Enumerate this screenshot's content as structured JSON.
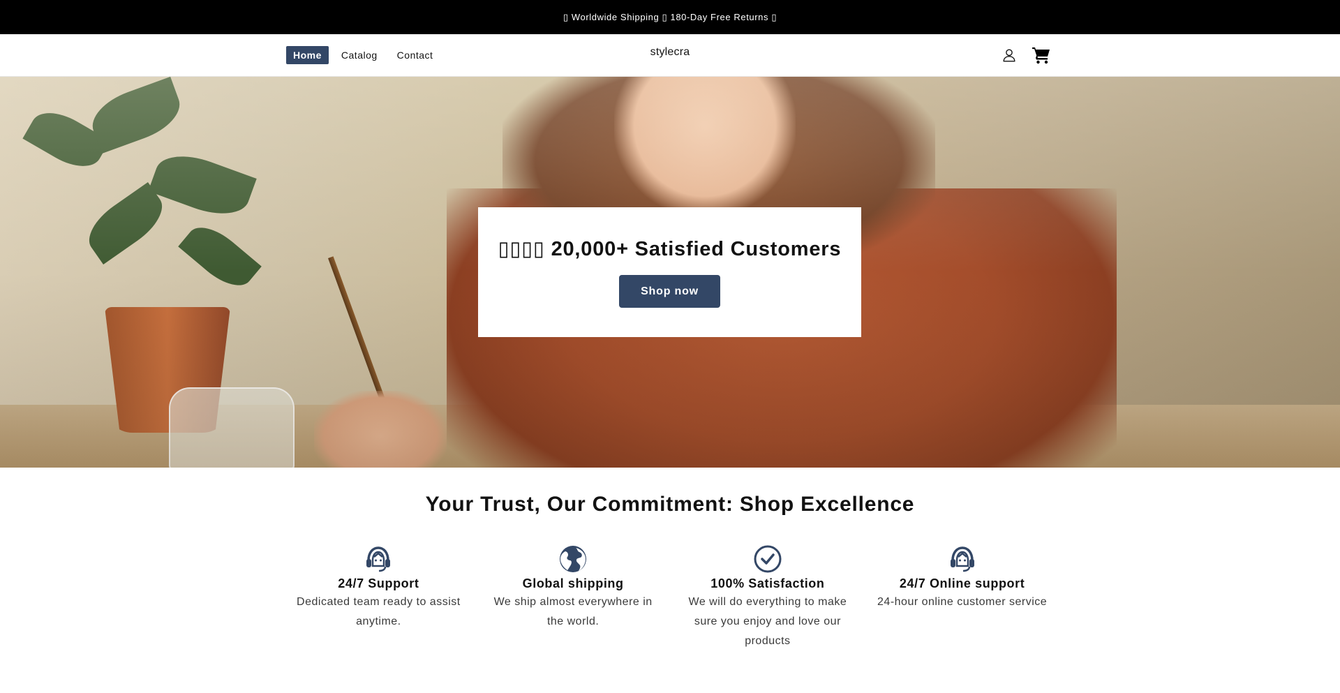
{
  "announcement": {
    "text": "▯ Worldwide Shipping ▯ 180-Day Free Returns ▯"
  },
  "header": {
    "nav": [
      {
        "label": "Home",
        "active": true
      },
      {
        "label": "Catalog",
        "active": false
      },
      {
        "label": "Contact",
        "active": false
      }
    ],
    "logo": "stylecra",
    "icons": [
      "account-icon",
      "cart-icon"
    ]
  },
  "hero": {
    "headline": "▯▯▯▯ 20,000+ Satisfied Customers",
    "cta_label": "Shop now",
    "accent_color": "#334766"
  },
  "trust": {
    "title": "Your Trust, Our Commitment: Shop Excellence",
    "features": [
      {
        "icon": "headset-icon",
        "title": "24/7 Support",
        "text": "Dedicated team ready to assist anytime."
      },
      {
        "icon": "globe-icon",
        "title": "Global shipping",
        "text": "We ship almost everywhere in the world."
      },
      {
        "icon": "check-circle-icon",
        "title": "100% Satisfaction",
        "text": "We will do everything to make sure you enjoy and love our products"
      },
      {
        "icon": "headset-icon",
        "title": "24/7 Online support",
        "text": "24-hour online customer service"
      }
    ]
  }
}
